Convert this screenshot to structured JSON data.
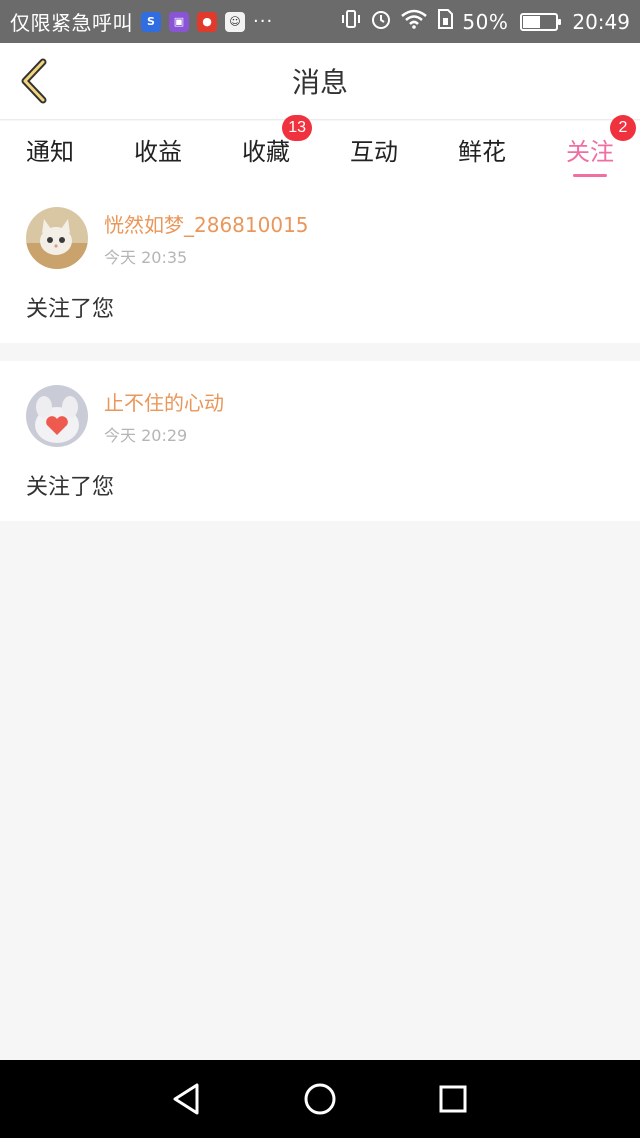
{
  "status_bar": {
    "carrier_text": "仅限紧急呼叫",
    "apps": [
      "shield-app",
      "gallery-app",
      "red-app",
      "chat-app"
    ],
    "more": "···",
    "battery_percent": "50%",
    "battery_level": 0.5,
    "time": "20:49"
  },
  "header": {
    "title": "消息"
  },
  "tabs": [
    {
      "label": "通知",
      "badge": ""
    },
    {
      "label": "收益",
      "badge": ""
    },
    {
      "label": "收藏",
      "badge": "13"
    },
    {
      "label": "互动",
      "badge": ""
    },
    {
      "label": "鲜花",
      "badge": ""
    },
    {
      "label": "关注",
      "badge": "2",
      "active": true
    }
  ],
  "messages": [
    {
      "name": "恍然如梦_286810015",
      "time": "今天 20:35",
      "text": "关注了您"
    },
    {
      "name": "止不住的心动",
      "time": "今天 20:29",
      "text": "关注了您"
    }
  ],
  "colors": {
    "accent": "#ef6fa3",
    "badge": "#f0323f",
    "username": "#e9975a"
  }
}
